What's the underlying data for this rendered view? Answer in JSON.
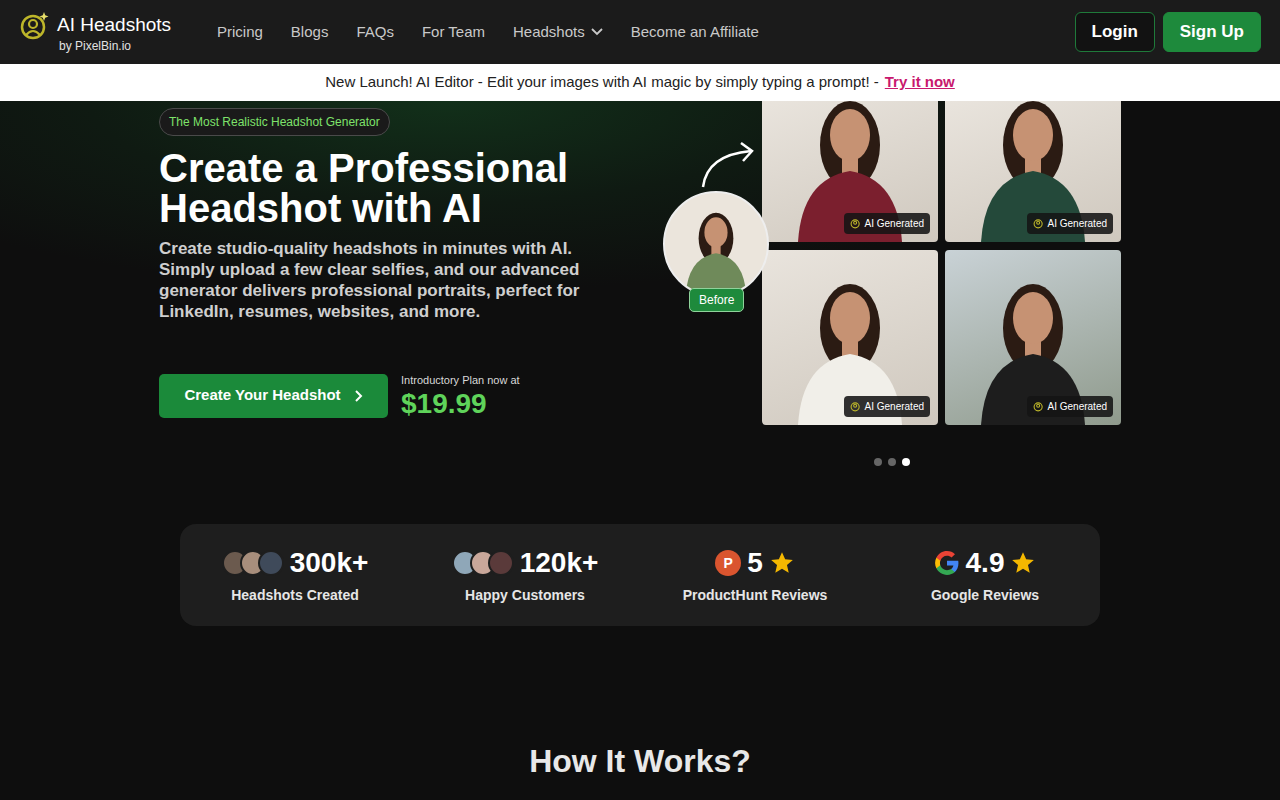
{
  "brand": {
    "title": "AI Headshots",
    "subtitle": "by PixelBin.io"
  },
  "nav": [
    {
      "label": "Pricing",
      "kind": "link"
    },
    {
      "label": "Blogs",
      "kind": "link"
    },
    {
      "label": "FAQs",
      "kind": "link"
    },
    {
      "label": "For Team",
      "kind": "link"
    },
    {
      "label": "Headshots",
      "kind": "dropdown"
    },
    {
      "label": "Become an Affiliate",
      "kind": "link"
    }
  ],
  "auth": {
    "login": "Login",
    "signup": "Sign Up"
  },
  "announcement": {
    "text": "New Launch! AI Editor - Edit your images with AI magic by simply typing a prompt! -",
    "link": "Try it now"
  },
  "hero": {
    "badge": "The Most Realistic Headshot Generator",
    "title": "Create a Professional Headshot with AI",
    "description": "Create studio-quality headshots in minutes with AI. Simply upload a few clear selfies, and our advanced generator delivers professional portraits, perfect for LinkedIn, resumes, websites, and more.",
    "cta": "Create Your Headshot",
    "price_label": "Introductory Plan now at",
    "price": "$19.99",
    "before_label": "Before",
    "gallery": [
      {
        "tag": "AI Generated"
      },
      {
        "tag": "AI Generated"
      },
      {
        "tag": "AI Generated"
      },
      {
        "tag": "AI Generated"
      }
    ],
    "carousel": [
      {
        "selected": false
      },
      {
        "selected": false
      },
      {
        "selected": true
      }
    ]
  },
  "stats": [
    {
      "value": "300k+",
      "label": "Headshots Created",
      "kind": "avatars"
    },
    {
      "value": "120k+",
      "label": "Happy Customers",
      "kind": "avatars"
    },
    {
      "value": "5",
      "label": "ProductHunt Reviews",
      "kind": "producthunt",
      "logo": "P",
      "stars": 1
    },
    {
      "value": "4.9",
      "label": "Google Reviews",
      "kind": "google",
      "stars": 1
    }
  ],
  "how": {
    "title": "How It Works?"
  }
}
